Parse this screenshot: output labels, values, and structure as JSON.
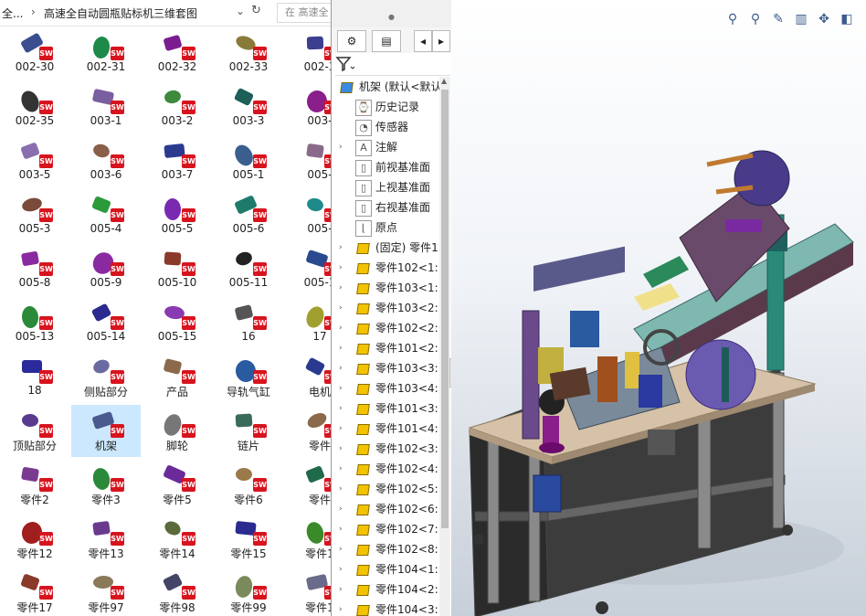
{
  "explorer": {
    "breadcrumb_prev": "全...",
    "breadcrumb_sep": "›",
    "breadcrumb_current": "高速全自动圆瓶贴标机三维套图",
    "search_placeholder": "在 高速全",
    "files": [
      {
        "label": "002-30",
        "color": "#3a4d8f"
      },
      {
        "label": "002-31",
        "color": "#1e8a4a"
      },
      {
        "label": "002-32",
        "color": "#7a1e8f"
      },
      {
        "label": "002-33",
        "color": "#8a7a3a"
      },
      {
        "label": "002-3",
        "color": "#3a3f8f"
      },
      {
        "label": "002-35",
        "color": "#333333"
      },
      {
        "label": "003-1",
        "color": "#7a5fa0"
      },
      {
        "label": "003-2",
        "color": "#3d8a3d"
      },
      {
        "label": "003-3",
        "color": "#1e5f5a"
      },
      {
        "label": "003-",
        "color": "#8a1e8a"
      },
      {
        "label": "003-5",
        "color": "#8a6fb0"
      },
      {
        "label": "003-6",
        "color": "#8a5f4a"
      },
      {
        "label": "003-7",
        "color": "#2a3a8f"
      },
      {
        "label": "005-1",
        "color": "#3a5f8f"
      },
      {
        "label": "005-",
        "color": "#8a6a8a"
      },
      {
        "label": "005-3",
        "color": "#7a4a3a"
      },
      {
        "label": "005-4",
        "color": "#2a9a3a"
      },
      {
        "label": "005-5",
        "color": "#7a2ab0"
      },
      {
        "label": "005-6",
        "color": "#1e7a6a"
      },
      {
        "label": "005-",
        "color": "#1e8a8a"
      },
      {
        "label": "005-8",
        "color": "#8a2aa0"
      },
      {
        "label": "005-9",
        "color": "#8a2aa0"
      },
      {
        "label": "005-10",
        "color": "#8a3a2a"
      },
      {
        "label": "005-11",
        "color": "#222222"
      },
      {
        "label": "005-1",
        "color": "#2a4a8f"
      },
      {
        "label": "005-13",
        "color": "#2a8a3a"
      },
      {
        "label": "005-14",
        "color": "#2a2a8f"
      },
      {
        "label": "005-15",
        "color": "#8a3ab0"
      },
      {
        "label": "16",
        "color": "#555555"
      },
      {
        "label": "17",
        "color": "#a0a030"
      },
      {
        "label": "18",
        "color": "#2a2a9a"
      },
      {
        "label": "侧贴部分",
        "color": "#6a6aa0"
      },
      {
        "label": "产品",
        "color": "#8a6a4a"
      },
      {
        "label": "导轨气缸",
        "color": "#2a5aa0"
      },
      {
        "label": "电机",
        "color": "#2a3a8f"
      },
      {
        "label": "顶贴部分",
        "color": "#5a3a8f"
      },
      {
        "label": "机架",
        "color": "#4a5a8f"
      },
      {
        "label": "脚轮",
        "color": "#777777"
      },
      {
        "label": "链片",
        "color": "#3a6a5a"
      },
      {
        "label": "零件",
        "color": "#8a6a4a"
      },
      {
        "label": "零件2",
        "color": "#7a3a8f"
      },
      {
        "label": "零件3",
        "color": "#2a8a3a"
      },
      {
        "label": "零件5",
        "color": "#6a2a9a"
      },
      {
        "label": "零件6",
        "color": "#9a7a4a"
      },
      {
        "label": "零件",
        "color": "#1e6a4a"
      },
      {
        "label": "零件12",
        "color": "#a01e1e"
      },
      {
        "label": "零件13",
        "color": "#6a3a8f"
      },
      {
        "label": "零件14",
        "color": "#5a6a3a"
      },
      {
        "label": "零件15",
        "color": "#2a2a8f"
      },
      {
        "label": "零件1",
        "color": "#3a8a2a"
      },
      {
        "label": "零件17",
        "color": "#8a3a2a"
      },
      {
        "label": "零件97",
        "color": "#8a7a5a"
      },
      {
        "label": "零件98",
        "color": "#444466"
      },
      {
        "label": "零件99",
        "color": "#7a8a5a"
      },
      {
        "label": "零件1",
        "color": "#6a6a8a"
      }
    ]
  },
  "feature_manager": {
    "tabs": [
      "⚙",
      "▤",
      "◂",
      "▸"
    ],
    "filter_icon": "funnel-icon",
    "tree": [
      {
        "label": "机架  (默认<默认",
        "type": "assembly",
        "arrow": "",
        "depth": 0
      },
      {
        "label": "历史记录",
        "type": "history",
        "arrow": "",
        "depth": 1
      },
      {
        "label": "传感器",
        "type": "sensor",
        "arrow": "",
        "depth": 1
      },
      {
        "label": "注解",
        "type": "annotation",
        "arrow": "›",
        "depth": 1
      },
      {
        "label": "前视基准面",
        "type": "plane",
        "arrow": "",
        "depth": 1
      },
      {
        "label": "上视基准面",
        "type": "plane",
        "arrow": "",
        "depth": 1
      },
      {
        "label": "右视基准面",
        "type": "plane",
        "arrow": "",
        "depth": 1
      },
      {
        "label": "原点",
        "type": "origin",
        "arrow": "",
        "depth": 1
      },
      {
        "label": "(固定) 零件1",
        "type": "part",
        "arrow": "›",
        "depth": 1
      },
      {
        "label": "零件102<1:",
        "type": "part",
        "arrow": "›",
        "depth": 1
      },
      {
        "label": "零件103<1:",
        "type": "part",
        "arrow": "›",
        "depth": 1
      },
      {
        "label": "零件103<2:",
        "type": "part",
        "arrow": "›",
        "depth": 1
      },
      {
        "label": "零件102<2:",
        "type": "part",
        "arrow": "›",
        "depth": 1
      },
      {
        "label": "零件101<2:",
        "type": "part",
        "arrow": "›",
        "depth": 1
      },
      {
        "label": "零件103<3:",
        "type": "part",
        "arrow": "›",
        "depth": 1
      },
      {
        "label": "零件103<4:",
        "type": "part",
        "arrow": "›",
        "depth": 1
      },
      {
        "label": "零件101<3:",
        "type": "part",
        "arrow": "›",
        "depth": 1
      },
      {
        "label": "零件101<4:",
        "type": "part",
        "arrow": "›",
        "depth": 1
      },
      {
        "label": "零件102<3:",
        "type": "part",
        "arrow": "›",
        "depth": 1
      },
      {
        "label": "零件102<4:",
        "type": "part",
        "arrow": "›",
        "depth": 1
      },
      {
        "label": "零件102<5:",
        "type": "part",
        "arrow": "›",
        "depth": 1
      },
      {
        "label": "零件102<6:",
        "type": "part",
        "arrow": "›",
        "depth": 1
      },
      {
        "label": "零件102<7:",
        "type": "part",
        "arrow": "›",
        "depth": 1
      },
      {
        "label": "零件102<8:",
        "type": "part",
        "arrow": "›",
        "depth": 1
      },
      {
        "label": "零件104<1:",
        "type": "part",
        "arrow": "›",
        "depth": 1
      },
      {
        "label": "零件104<2:",
        "type": "part",
        "arrow": "›",
        "depth": 1
      },
      {
        "label": "零件104<3:",
        "type": "part",
        "arrow": "›",
        "depth": 1
      }
    ]
  },
  "viewport": {
    "hud_icons": [
      "zoom-to-fit-icon",
      "zoom-area-icon",
      "previous-view-icon",
      "section-view-icon",
      "view-orientation-icon",
      "display-style-icon"
    ],
    "hud_glyphs": [
      "⚲",
      "⚲",
      "✎",
      "▥",
      "✥",
      "◧"
    ]
  }
}
